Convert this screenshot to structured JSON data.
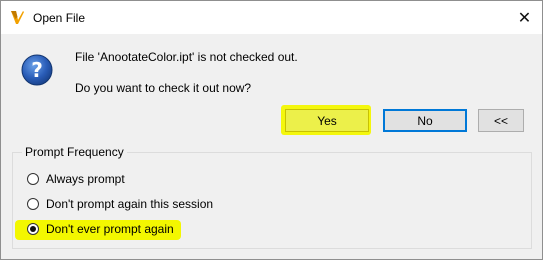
{
  "window": {
    "title": "Open File",
    "close_glyph": "✕"
  },
  "message": {
    "line1": "File 'AnootateColor.ipt' is not checked out.",
    "line2": "Do you want to check it out now?"
  },
  "buttons": {
    "yes": "Yes",
    "no": "No",
    "more": "<<"
  },
  "prompt_frequency": {
    "title": "Prompt Frequency",
    "options": [
      {
        "label": "Always prompt",
        "checked": false
      },
      {
        "label": "Don't prompt again this session",
        "checked": false
      },
      {
        "label": "Don't ever prompt again",
        "checked": true
      }
    ]
  },
  "colors": {
    "highlight": "#f3f700",
    "focus_border": "#0078d7",
    "icon_blue": "#1f4fa6",
    "app_logo": "#f2a100"
  },
  "icons": {
    "app": "autodesk-v-logo",
    "message": "question-icon"
  }
}
